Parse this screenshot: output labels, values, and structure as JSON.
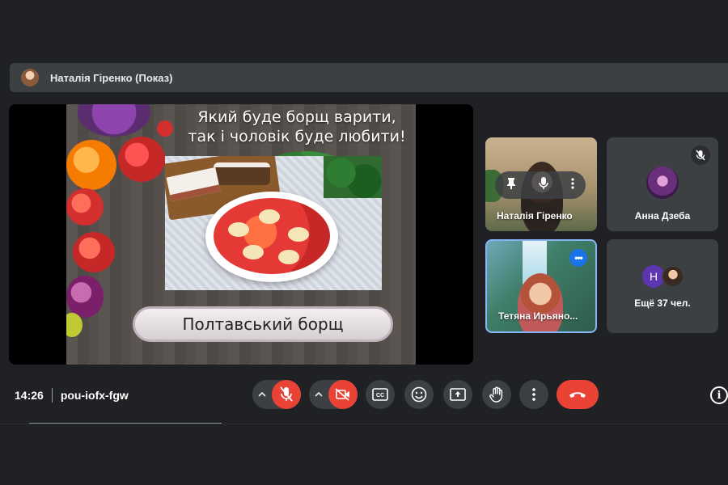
{
  "presenter": {
    "label": "Наталія Гіренко (Показ)"
  },
  "slide": {
    "caption_line1": "Який буде борщ варити,",
    "caption_line2": "так і чоловік буде любити!",
    "title": "Полтавський борщ"
  },
  "participants": [
    {
      "name": "Наталія Гіренко",
      "type": "video",
      "hover_controls": [
        "pin-icon",
        "mic-icon",
        "more-vert-icon"
      ]
    },
    {
      "name": "Анна Дзеба",
      "type": "avatar",
      "muted": true
    },
    {
      "name": "Тетяна Ирьяно...",
      "type": "video",
      "active": true,
      "more_button": "•••"
    },
    {
      "name": "Ещё 37 чел.",
      "type": "overflow",
      "avatar_letter": "H"
    }
  ],
  "meeting": {
    "time": "14:26",
    "code": "pou-iofx-fgw"
  },
  "controls": {
    "items": [
      "mic-off-icon",
      "camera-off-icon",
      "captions-icon",
      "emoji-icon",
      "present-icon",
      "raise-hand-icon",
      "more-options-icon",
      "end-call-icon",
      "info-icon"
    ],
    "info_glyph": "i"
  },
  "colors": {
    "background": "#202124",
    "surface": "#3c4043",
    "danger": "#ea4335",
    "accent": "#1a73e8"
  }
}
